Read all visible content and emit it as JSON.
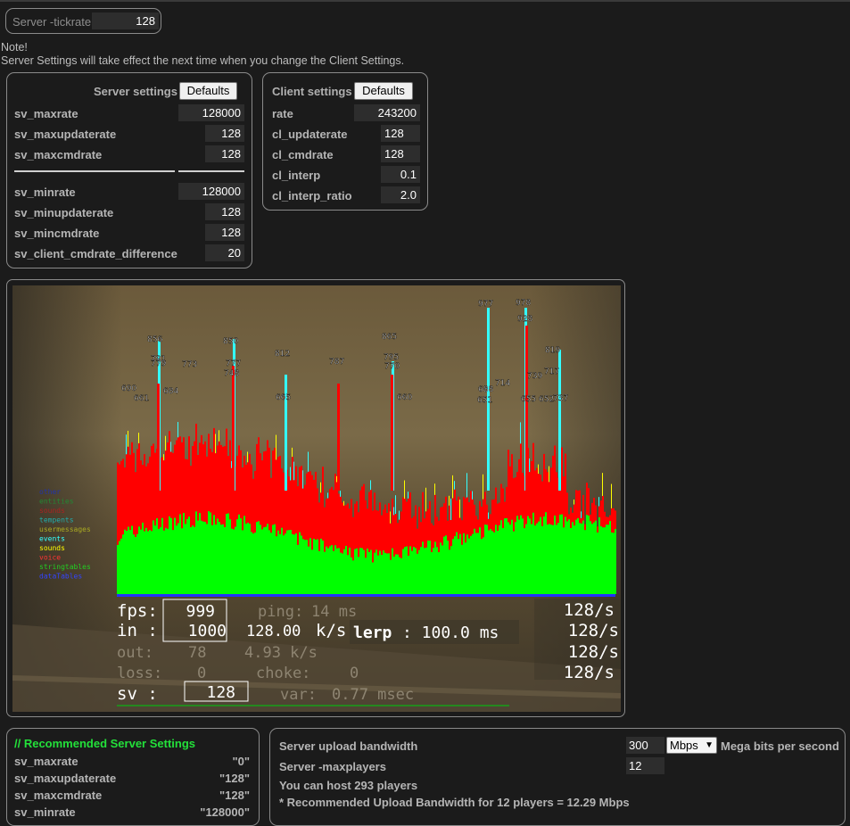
{
  "tickrate": {
    "label": "Server -tickrate",
    "value": "128"
  },
  "note": {
    "line1": "Note!",
    "line2": "Server Settings will take effect the next time when you change the Client Settings."
  },
  "server_settings": {
    "title": "Server settings",
    "defaults_label": "Defaults",
    "rows": [
      {
        "label": "sv_maxrate",
        "value": "128000"
      },
      {
        "label": "sv_maxupdaterate",
        "value": "128"
      },
      {
        "label": "sv_maxcmdrate",
        "value": "128"
      },
      {
        "label": "sv_minrate",
        "value": "128000"
      },
      {
        "label": "sv_minupdaterate",
        "value": "128"
      },
      {
        "label": "sv_mincmdrate",
        "value": "128"
      },
      {
        "label": "sv_client_cmdrate_difference",
        "value": "20"
      }
    ]
  },
  "client_settings": {
    "title": "Client settings",
    "defaults_label": "Defaults",
    "rows": [
      {
        "label": "rate",
        "value": "243200"
      },
      {
        "label": "cl_updaterate",
        "value": "128"
      },
      {
        "label": "cl_cmdrate",
        "value": "128"
      },
      {
        "label": "cl_interp",
        "value": "0.1"
      },
      {
        "label": "cl_interp_ratio",
        "value": "2.0"
      }
    ]
  },
  "netgraph": {
    "peak_labels": [
      "856",
      "850",
      "812",
      "787",
      "865",
      "977",
      "978",
      "928",
      "819",
      "791",
      "779",
      "773",
      "777",
      "748",
      "795",
      "770",
      "690",
      "661",
      "684",
      "665",
      "660",
      "688",
      "714",
      "739",
      "717",
      "651",
      "655",
      "652",
      "737"
    ],
    "legend": [
      "other",
      "entities",
      "sounds",
      "tempents",
      "usermessages",
      "events",
      "sounds",
      "voice",
      "stringtables",
      "dataTables"
    ],
    "fps_label": "fps:",
    "fps_value": "999",
    "in_label": "in :",
    "in_value": "1000",
    "in_kbs": "128.00",
    "kbs_label": "k/s",
    "lerp_label": "lerp",
    "lerp_value": ": 100.0 ms",
    "ping_label": "ping:",
    "ping_value": "14 ms",
    "out_label": "out:",
    "out_value": "78",
    "out_kbs": "4.93 k/s",
    "loss_label": "loss:",
    "loss_value": "0",
    "choke_label": "choke:",
    "choke_value": "0",
    "sv_label": "sv :",
    "sv_value": "128",
    "var_label": "var:",
    "var_value": "0.77 msec",
    "rates": [
      "128/s",
      "128/s",
      "128/s",
      "128/s"
    ],
    "colors": {
      "green": "#00ff00",
      "red": "#ff0000",
      "cyan": "#33ffff",
      "yellow": "#ffff00",
      "blue": "#2233ff"
    }
  },
  "recommended": {
    "title": "// Recommended Server Settings",
    "rows": [
      {
        "label": "sv_maxrate",
        "value": "\"0\""
      },
      {
        "label": "sv_maxupdaterate",
        "value": "\"128\""
      },
      {
        "label": "sv_maxcmdrate",
        "value": "\"128\""
      },
      {
        "label": "sv_minrate",
        "value": "\"128000\""
      }
    ]
  },
  "bandwidth": {
    "upload_label": "Server upload bandwidth",
    "upload_value": "300",
    "unit_selected": "Mbps",
    "unit_desc": "Mega bits per second",
    "maxplayers_label": "Server -maxplayers",
    "maxplayers_value": "12",
    "host_text": "You can host 293 players",
    "recommend_text": "* Recommended Upload Bandwidth for 12 players = 12.29 Mbps"
  }
}
